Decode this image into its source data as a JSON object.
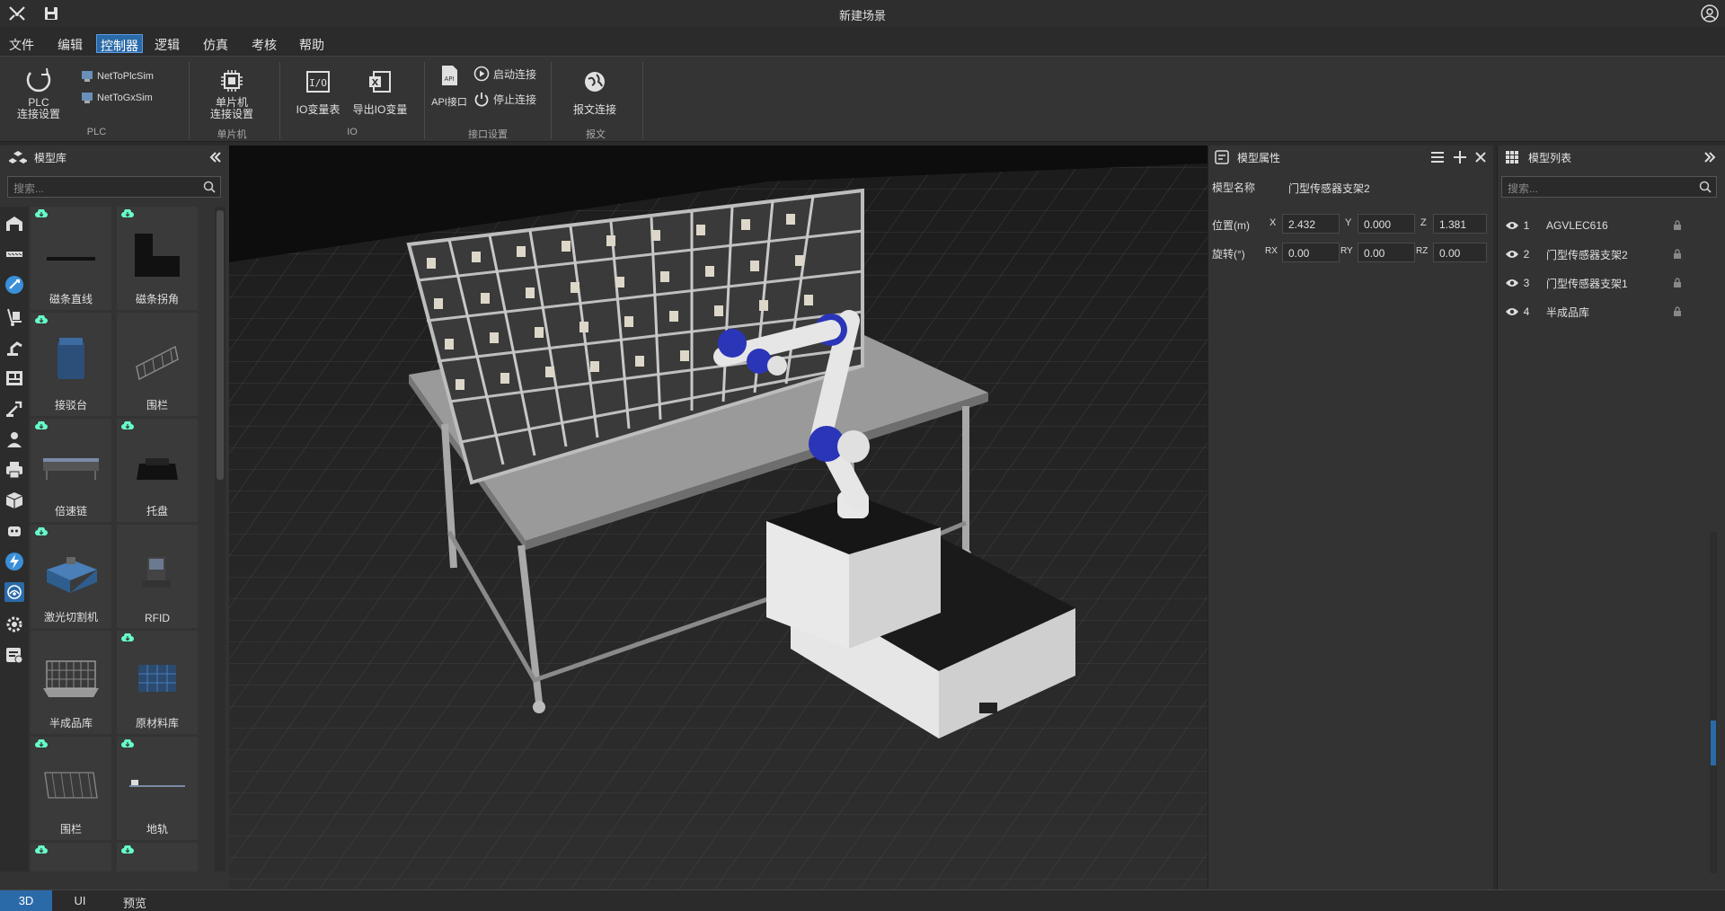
{
  "window": {
    "title": "新建场景"
  },
  "menu": [
    "文件",
    "编辑",
    "控制器",
    "逻辑",
    "仿真",
    "考核",
    "帮助"
  ],
  "menu_active": "控制器",
  "ribbon": {
    "plc_setup_line1": "PLC",
    "plc_setup_line2": "连接设置",
    "net_to_plcsim": "NetToPlcSim",
    "net_to_gxsim": "NetToGxSim",
    "group_plc": "PLC",
    "mcu_setup_line1": "单片机",
    "mcu_setup_line2": "连接设置",
    "group_mcu": "单片机",
    "io_table": "IO变量表",
    "export_io": "导出IO变量",
    "group_io": "IO",
    "api_port": "API接口",
    "start_conn": "启动连接",
    "stop_conn": "停止连接",
    "group_interface": "接口设置",
    "msg_conn": "报文连接",
    "group_msg": "报文"
  },
  "left_panel": {
    "title": "模型库",
    "search_placeholder": "搜索...",
    "items": [
      "磁条直线",
      "磁条拐角",
      "接驳台",
      "围栏",
      "倍速链",
      "托盘",
      "激光切割机",
      "RFID",
      "半成品库",
      "原材料库",
      "围栏",
      "地轨"
    ]
  },
  "props": {
    "title": "模型属性",
    "name_label": "模型名称",
    "name_value": "门型传感器支架2",
    "pos_label": "位置(m)",
    "rot_label": "旋转(°)",
    "x_label": "X",
    "y_label": "Y",
    "z_label": "Z",
    "x": "2.432",
    "y": "0.000",
    "z": "1.381",
    "rx_label": "RX",
    "ry_label": "RY",
    "rz_label": "RZ",
    "rx": "0.00",
    "ry": "0.00",
    "rz": "0.00"
  },
  "model_list": {
    "title": "模型列表",
    "search_placeholder": "搜索...",
    "rows": [
      {
        "idx": "1",
        "name": "AGVLEC616"
      },
      {
        "idx": "2",
        "name": "门型传感器支架2"
      },
      {
        "idx": "3",
        "name": "门型传感器支架1"
      },
      {
        "idx": "4",
        "name": "半成品库"
      }
    ]
  },
  "bottom_tabs": [
    "3D",
    "UI",
    "预览"
  ],
  "colors": {
    "accent": "#2b6aa8",
    "panel": "#333333",
    "viewport": "#141414"
  }
}
